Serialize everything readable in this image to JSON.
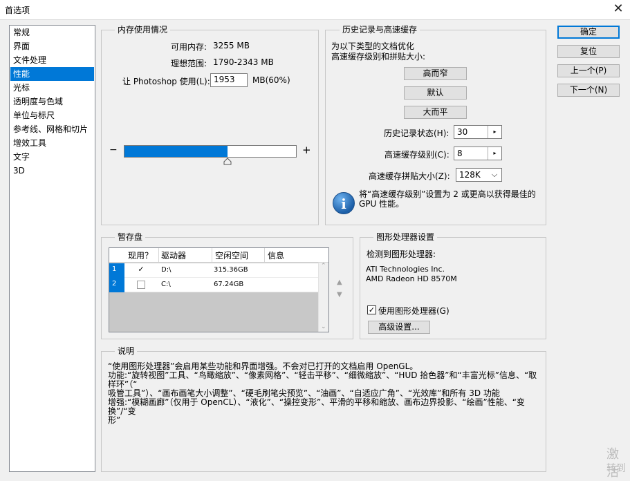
{
  "window": {
    "title": "首选项",
    "close_glyph": "✕"
  },
  "sidebar": {
    "items": [
      "常规",
      "界面",
      "文件处理",
      "性能",
      "光标",
      "透明度与色域",
      "单位与标尺",
      "参考线、网格和切片",
      "增效工具",
      "文字",
      "3D"
    ],
    "selected": "性能"
  },
  "memory": {
    "title": "内存使用情况",
    "available_label": "可用内存:",
    "available_value": "3255 MB",
    "ideal_label": "理想范围:",
    "ideal_value": "1790-2343 MB",
    "let_label": "让 Photoshop 使用(L):",
    "let_value": "1953",
    "let_unit": "MB(60%)",
    "minus": "−",
    "plus": "+",
    "slider_fraction": 0.6
  },
  "history": {
    "title": "历史记录与高速缓存",
    "intro_line1": "为以下类型的文档优化",
    "intro_line2": "高速缓存级别和拼贴大小:",
    "btn_tall_thin": "高而窄",
    "btn_default": "默认",
    "btn_big_flat": "大而平",
    "states_label": "历史记录状态(H):",
    "states_value": "30",
    "cache_levels_label": "高速缓存级别(C):",
    "cache_levels_value": "8",
    "tile_size_label": "高速缓存拼贴大小(Z):",
    "tile_size_value": "128K",
    "note_line1": "将“高速缓存级别”设置为 2 或更高以获得最佳的",
    "note_line2": "GPU 性能。",
    "spin_arrow": "▸",
    "dropdown_arrow": "⌵",
    "info_glyph": "i"
  },
  "scratch": {
    "title": "暂存盘",
    "headers": [
      "现用？",
      "驱动器",
      "空闲空间",
      "信息"
    ],
    "rows": [
      {
        "num": "1",
        "active": true,
        "drive": "D:\\",
        "free": "315.36GB",
        "info": ""
      },
      {
        "num": "2",
        "active": false,
        "drive": "C:\\",
        "free": "67.24GB",
        "info": ""
      }
    ],
    "check_glyph": "✓",
    "up_arrow": "▲",
    "down_arrow": "▼",
    "scroll_up": "⌃",
    "scroll_down": "⌄"
  },
  "gpu": {
    "title": "图形处理器设置",
    "detected_label": "检测到图形处理器:",
    "vendor": "ATI Technologies Inc.",
    "model": "AMD Radeon HD 8570M",
    "use_gpu_label": "使用图形处理器(G)",
    "use_gpu_checked": true,
    "advanced_button": "高级设置..."
  },
  "description": {
    "title": "说明",
    "line1": "“使用图形处理器”会启用某些功能和界面增强。不会对已打开的文档启用 OpenGL。",
    "line2": "功能:“旋转视图”工具、“鸟瞰缩放”、“像素网格”、“轻击平移”、“细微缩放”、“HUD 拾色器”和“丰富光标”信息、“取样环”（“",
    "line3": "吸管工具”）、“画布画笔大小调整”、“硬毛刷笔尖预览”、“油画”、“自适应广角”、“光效库”和所有 3D 功能",
    "line4": "增强:“模糊画廊”（仅用于 OpenCL）、“液化”、“操控变形”、平滑的平移和缩放、画布边界投影、“绘画”性能、“变换”/“变",
    "line5": "形”"
  },
  "buttons": {
    "ok": "确定",
    "reset": "复位",
    "prev": "上一个(P)",
    "next": "下一个(N)"
  },
  "watermark": {
    "line1": "激活",
    "line2": "转到"
  },
  "colors": {
    "accent": "#0078d7",
    "button_face": "#e1e1e1",
    "panel": "#f0f0f0"
  }
}
